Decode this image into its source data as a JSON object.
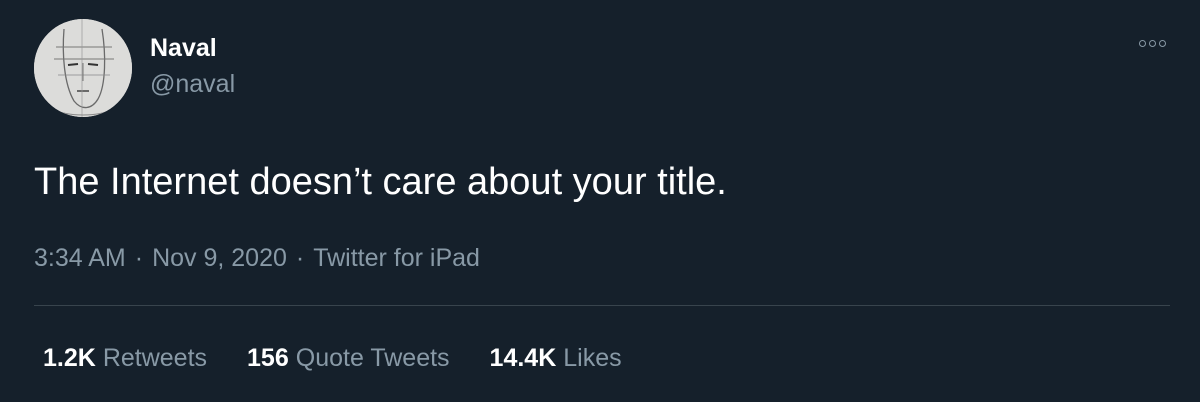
{
  "author": {
    "display_name": "Naval",
    "handle": "@naval",
    "avatar_icon": "sketch-face-avatar"
  },
  "tweet": {
    "text": "The Internet doesn’t care about your title."
  },
  "meta": {
    "time": "3:34 AM",
    "separator": "·",
    "date": "Nov 9, 2020",
    "source": "Twitter for iPad"
  },
  "stats": [
    {
      "count": "1.2K",
      "label": "Retweets"
    },
    {
      "count": "156",
      "label": "Quote Tweets"
    },
    {
      "count": "14.4K",
      "label": "Likes"
    }
  ],
  "more_icon": "more-options-icon",
  "colors": {
    "background": "#15202b",
    "primary_text": "#ffffff",
    "secondary_text": "#8899a6",
    "divider": "#38444d"
  }
}
